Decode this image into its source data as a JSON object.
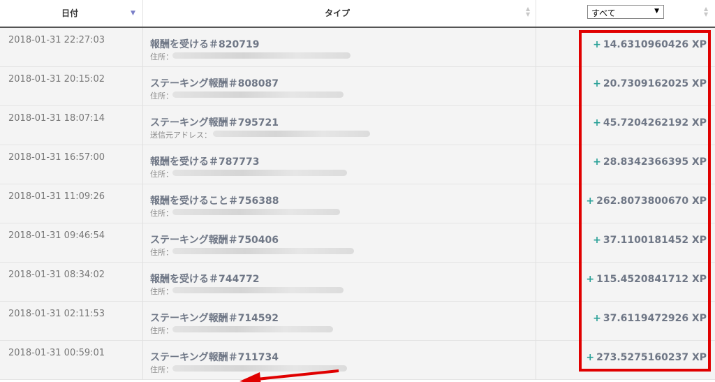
{
  "header": {
    "date_label": "日付",
    "type_label": "タイプ",
    "filter_value": "すべて"
  },
  "rows": [
    {
      "date": "2018-01-31 22:27:03",
      "title": "報酬を受ける＃820719",
      "addr_label": "住所：",
      "sign": "+",
      "amount": "14.6310960426 XP"
    },
    {
      "date": "2018-01-31 20:15:02",
      "title": "ステーキング報酬＃808087",
      "addr_label": "住所：",
      "sign": "+",
      "amount": "20.7309162025 XP"
    },
    {
      "date": "2018-01-31 18:07:14",
      "title": "ステーキング報酬＃795721",
      "addr_label": "送信元アドレス：",
      "sign": "+",
      "amount": "45.7204262192 XP"
    },
    {
      "date": "2018-01-31 16:57:00",
      "title": "報酬を受ける＃787773",
      "addr_label": "住所：",
      "sign": "+",
      "amount": "28.8342366395 XP"
    },
    {
      "date": "2018-01-31 11:09:26",
      "title": "報酬を受けること＃756388",
      "addr_label": "住所：",
      "sign": "+",
      "amount": "262.8073800670 XP"
    },
    {
      "date": "2018-01-31 09:46:54",
      "title": "ステーキング報酬＃750406",
      "addr_label": "住所：",
      "sign": "+",
      "amount": "37.1100181452 XP"
    },
    {
      "date": "2018-01-31 08:34:02",
      "title": "報酬を受ける＃744772",
      "addr_label": "住所：",
      "sign": "+",
      "amount": "115.4520841712 XP"
    },
    {
      "date": "2018-01-31 02:11:53",
      "title": "ステーキング報酬＃714592",
      "addr_label": "住所：",
      "sign": "+",
      "amount": "37.6119472926 XP"
    },
    {
      "date": "2018-01-31 00:59:01",
      "title": "ステーキング報酬＃711734",
      "addr_label": "住所：",
      "sign": "+",
      "amount": "273.5275160237 XP"
    }
  ],
  "colors": {
    "plus": "#2aa198",
    "highlight": "#e00000",
    "row_bg": "#f4f4f4"
  },
  "icons": {
    "sort_active": "sort-desc-icon",
    "sort_both": "sort-both-icon",
    "dropdown": "dropdown-arrow-icon"
  }
}
